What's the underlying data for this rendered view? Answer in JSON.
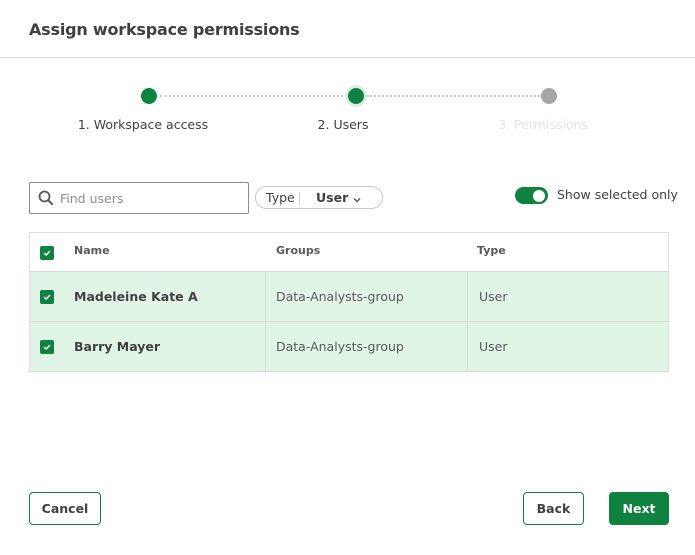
{
  "dialog": {
    "title": "Assign workspace permissions"
  },
  "stepper": {
    "steps": [
      {
        "label": "1. Workspace access",
        "state": "done"
      },
      {
        "label": "2. Users",
        "state": "active"
      },
      {
        "label": "3. Permissions",
        "state": "pending"
      }
    ]
  },
  "toolbar": {
    "search": {
      "placeholder": "Find users",
      "value": "",
      "icon": "search-icon"
    },
    "type_filter": {
      "label": "Type",
      "value": "User",
      "icon": "chevron-down-icon"
    },
    "toggle": {
      "label": "Show selected only",
      "on": true
    }
  },
  "table": {
    "columns": [
      "Name",
      "Groups",
      "Type"
    ],
    "select_all_checked": true,
    "rows": [
      {
        "name": "Madeleine Kate A",
        "groups": "Data-Analysts-group",
        "type": "User",
        "checked": true
      },
      {
        "name": "Barry Mayer",
        "groups": "Data-Analysts-group",
        "type": "User",
        "checked": true
      }
    ]
  },
  "footer": {
    "cancel_label": "Cancel",
    "back_label": "Back",
    "next_label": "Next"
  },
  "colors": {
    "accent": "#0f8240",
    "selected_row": "#e1f5e7",
    "pending_step": "#a6a6a6"
  }
}
